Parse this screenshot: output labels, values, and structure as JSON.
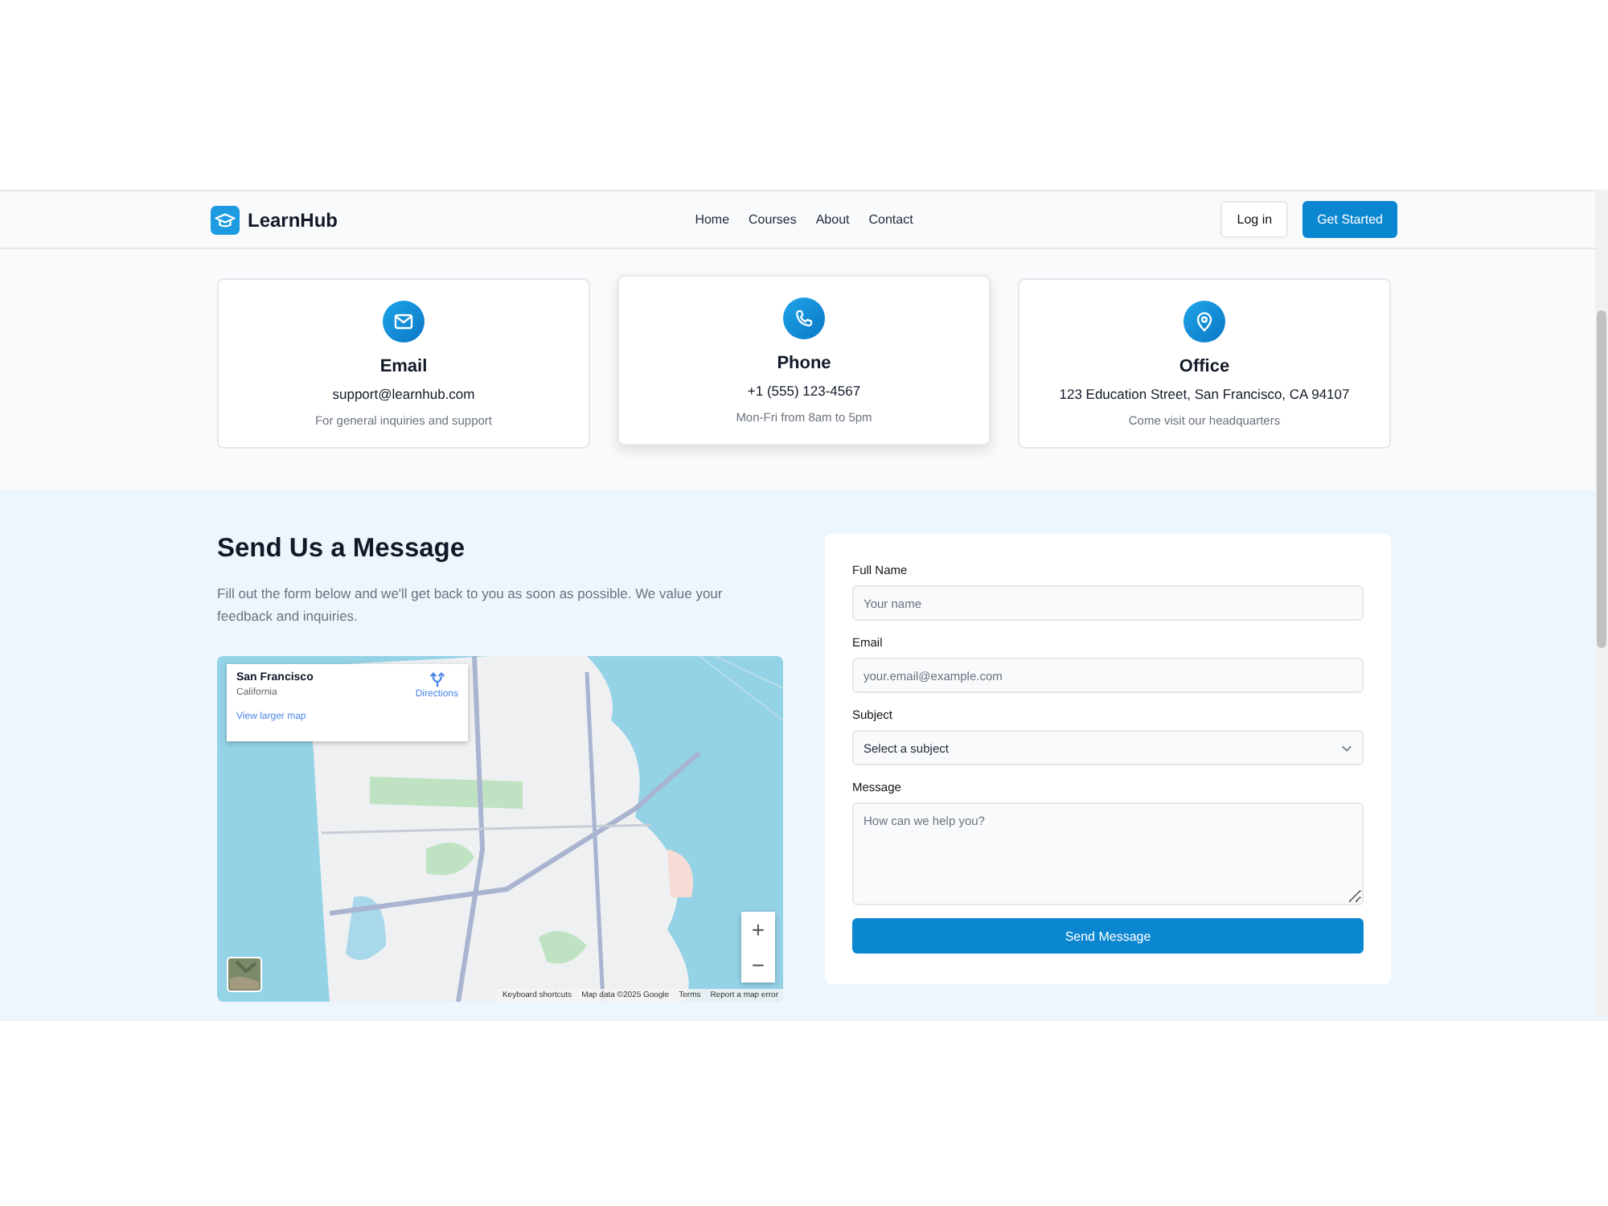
{
  "header": {
    "brand": "LearnHub",
    "nav": [
      {
        "label": "Home"
      },
      {
        "label": "Courses"
      },
      {
        "label": "About"
      },
      {
        "label": "Contact"
      }
    ],
    "login": "Log in",
    "cta": "Get Started"
  },
  "contact_cards": [
    {
      "kind": "email",
      "title": "Email",
      "value": "support@learnhub.com",
      "note": "For general inquiries and support",
      "raised": false
    },
    {
      "kind": "phone",
      "title": "Phone",
      "value": "+1 (555) 123-4567",
      "note": "Mon-Fri from 8am to 5pm",
      "raised": true
    },
    {
      "kind": "office",
      "title": "Office",
      "value": "123 Education Street, San Francisco, CA 94107",
      "note": "Come visit our headquarters",
      "raised": false
    }
  ],
  "message_section": {
    "title": "Send Us a Message",
    "intro": "Fill out the form below and we'll get back to you as soon as possible. We value your feedback and inquiries.",
    "map": {
      "kind": "picture",
      "place_card": {
        "title": "San Francisco",
        "subtitle": "California",
        "directions": "Directions",
        "larger_map": "View larger map"
      },
      "zoom_in": "+",
      "zoom_out": "−",
      "footer_links": [
        "Keyboard shortcuts",
        "Map data ©2025 Google",
        "Terms",
        "Report a map error"
      ]
    }
  },
  "form": {
    "fields": [
      {
        "kind": "input",
        "label": "Full Name",
        "placeholder": "Your name"
      },
      {
        "kind": "input",
        "label": "Email",
        "placeholder": "your.email@example.com"
      },
      {
        "kind": "select",
        "label": "Subject",
        "value": "Select a subject"
      },
      {
        "kind": "textarea",
        "label": "Message",
        "placeholder": "How can we help you?"
      }
    ],
    "submit": "Send Message"
  }
}
